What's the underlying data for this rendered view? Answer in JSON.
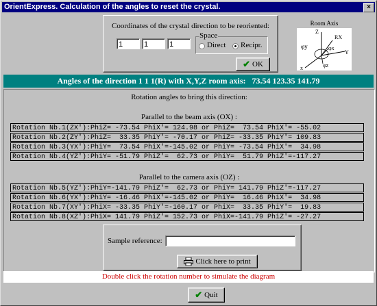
{
  "window": {
    "title": "OrientExpress. Calculation of the angles to reset the crystal.",
    "close": "×"
  },
  "coords": {
    "label": "Coordinates of the crystal direction  to be reoriented:",
    "values": [
      "1",
      "1",
      "1"
    ],
    "space_label": "Space",
    "direct": "Direct",
    "recipr": "Recipr.",
    "selected": "recipr",
    "ok": "OK"
  },
  "room_axis": {
    "title": "Room Axis",
    "z": "Z",
    "rx": "RX",
    "phi_y": "φy",
    "phi_x": "φx",
    "phi_z": "φz",
    "x": "x",
    "y": "Y"
  },
  "band": {
    "text": "Angles of the direction 1 1 1(R) with X,Y,Z room axis:",
    "angles": "73.54 123.35 141.79"
  },
  "rotation_header": "Rotation angles to bring this direction:",
  "beam": {
    "title": "Parallel to the beam axis (OX) :",
    "rows": [
      "Rotation Nb.1(ZX'):PhiZ= -73.54 PhiX'= 124.98 or PhiZ=  73.54 PhiX'= -55.02",
      "Rotation Nb.2(ZY'):PhiZ=  33.35 PhiY'= -70.17 or PhiZ= -33.35 PhiY'= 109.83",
      "Rotation Nb.3(YX'):PhiY=  73.54 PhiX'=-145.02 or PhiY= -73.54 PhiX'=  34.98",
      "Rotation Nb.4(YZ'):PhiY= -51.79 PhiZ'=  62.73 or PhiY=  51.79 PhiZ'=-117.27"
    ]
  },
  "camera": {
    "title": "Parallel to the camera axis (OZ) :",
    "rows": [
      "Rotation Nb.5(YZ'):PhiY=-141.79 PhiZ'=  62.73 or PhiY= 141.79 PhiZ'=-117.27",
      "Rotation Nb.6(YX'):PhiY= -16.46 PhiX'=-145.02 or PhiY=  16.46 PhiX'=  34.98",
      "Rotation Nb.7(XY'):PhiX= -33.35 PhiY'=-160.17 or PhiX=  33.35 PhiY'=  19.83",
      "Rotation Nb.8(XZ'):PhiX= 141.79 PhiZ'= 152.73 or PhiX=-141.79 PhiZ'= -27.27"
    ]
  },
  "sample": {
    "label": "Sample reference:",
    "value": "",
    "print": "Click here to print"
  },
  "hint": "Double click the rotation number to simulate the  diagram",
  "quit": "Quit",
  "colors": {
    "title_bar": "#000080",
    "band": "#008080",
    "hint": "#cc0000",
    "ok_check": "#008000"
  }
}
